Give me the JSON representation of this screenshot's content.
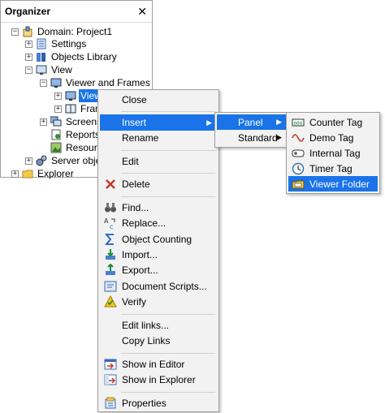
{
  "organizer": {
    "title": "Organizer",
    "close_glyph": "✕",
    "tree": [
      {
        "label": "Domain: Project1",
        "icon": "domain-icon"
      },
      {
        "label": "Settings",
        "icon": "settings-icon"
      },
      {
        "label": "Objects Library",
        "icon": "library-icon"
      },
      {
        "label": "View",
        "icon": "view-icon"
      },
      {
        "label": "Viewer and Frames",
        "icon": "monitor-icon"
      },
      {
        "label": "View",
        "icon": "monitor-icon"
      },
      {
        "label": "Fram",
        "icon": "frame-icon"
      },
      {
        "label": "Screens",
        "icon": "screens-icon"
      },
      {
        "label": "Reports",
        "icon": "reports-icon"
      },
      {
        "label": "Resourc",
        "icon": "resources-icon"
      },
      {
        "label": "Server obje",
        "icon": "gears-icon"
      },
      {
        "label": "Explorer",
        "icon": "folder-icon"
      }
    ]
  },
  "context_menu": {
    "close": "Close",
    "insert": "Insert",
    "rename": "Rename",
    "edit": "Edit",
    "delete": "Delete",
    "find": "Find...",
    "replace": "Replace...",
    "object_counting": "Object Counting",
    "import": "Import...",
    "export": "Export...",
    "document_scripts": "Document Scripts...",
    "verify": "Verify",
    "edit_links": "Edit links...",
    "copy_links": "Copy Links",
    "show_in_editor": "Show in Editor",
    "show_in_explorer": "Show in Explorer",
    "properties": "Properties"
  },
  "insert_submenu": {
    "panel": "Panel",
    "standard": "Standard"
  },
  "panel_submenu": {
    "counter_tag": "Counter Tag",
    "demo_tag": "Demo Tag",
    "internal_tag": "Internal Tag",
    "timer_tag": "Timer Tag",
    "viewer_folder": "Viewer Folder"
  },
  "colors": {
    "highlight": "#1a73e8",
    "menu_bg": "#f2f2f2"
  }
}
